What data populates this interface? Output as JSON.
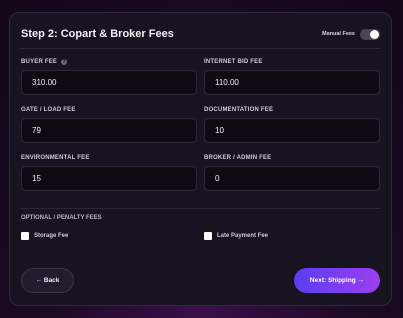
{
  "header": {
    "title": "Step 2: Copart & Broker Fees",
    "toggle_label": "Manual Fees",
    "toggle_on": false
  },
  "fields": [
    {
      "label": "BUYER FEE",
      "value": "310.00",
      "help_icon": "?"
    },
    {
      "label": "INTERNET BID FEE",
      "value": "110.00"
    },
    {
      "label": "GATE / LOAD FEE",
      "value": "79"
    },
    {
      "label": "DOCUMENTATION FEE",
      "value": "10"
    },
    {
      "label": "ENVIRONMENTAL FEE",
      "value": "15"
    },
    {
      "label": "BROKER / ADMIN FEE",
      "value": "0"
    }
  ],
  "optional": {
    "label": "OPTIONAL / PENALTY FEES",
    "items": [
      {
        "label": "Storage Fee",
        "checked": false
      },
      {
        "label": "Late Payment Fee",
        "checked": false
      }
    ]
  },
  "buttons": {
    "back": "← Back",
    "next": "Next: Shipping →"
  },
  "colors": {
    "accent_start": "#5a3df2",
    "accent_end": "#9b3ff0",
    "card_bg": "#171320"
  }
}
